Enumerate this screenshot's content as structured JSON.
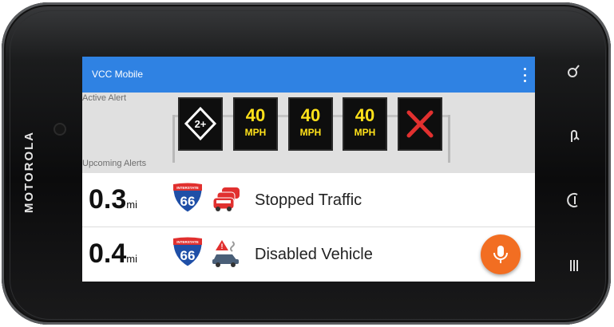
{
  "device": {
    "brand": "MOTOROLA"
  },
  "app": {
    "title": "VCC Mobile",
    "overflow_icon": "more-vert-icon"
  },
  "active_alert": {
    "label": "Active Alert",
    "signs": [
      {
        "kind": "hov",
        "text": "2+",
        "icon": "hov-diamond-icon"
      },
      {
        "kind": "speed",
        "speed": "40",
        "unit": "MPH"
      },
      {
        "kind": "speed",
        "speed": "40",
        "unit": "MPH"
      },
      {
        "kind": "speed",
        "speed": "40",
        "unit": "MPH"
      },
      {
        "kind": "lane-closed",
        "icon": "red-x-icon"
      }
    ]
  },
  "upcoming": {
    "label": "Upcoming Alerts",
    "items": [
      {
        "distance": "0.3",
        "unit": "mi",
        "route_top": "INTERSTATE",
        "route": "66",
        "icon": "traffic-jam-icon",
        "label": "Stopped Traffic"
      },
      {
        "distance": "0.4",
        "unit": "mi",
        "route_top": "INTERSTATE",
        "route": "66",
        "icon": "disabled-vehicle-icon",
        "label": "Disabled Vehicle"
      }
    ]
  },
  "fab": {
    "icon": "microphone-icon"
  },
  "nav_keys": [
    "search-key-icon",
    "back-key-icon",
    "home-key-icon",
    "menu-key-icon"
  ],
  "colors": {
    "appbar": "#2f82e3",
    "sign_text": "#ffe11a",
    "fab": "#f26e22",
    "alert_red": "#e1302f",
    "shield_blue": "#1f4fa7"
  }
}
